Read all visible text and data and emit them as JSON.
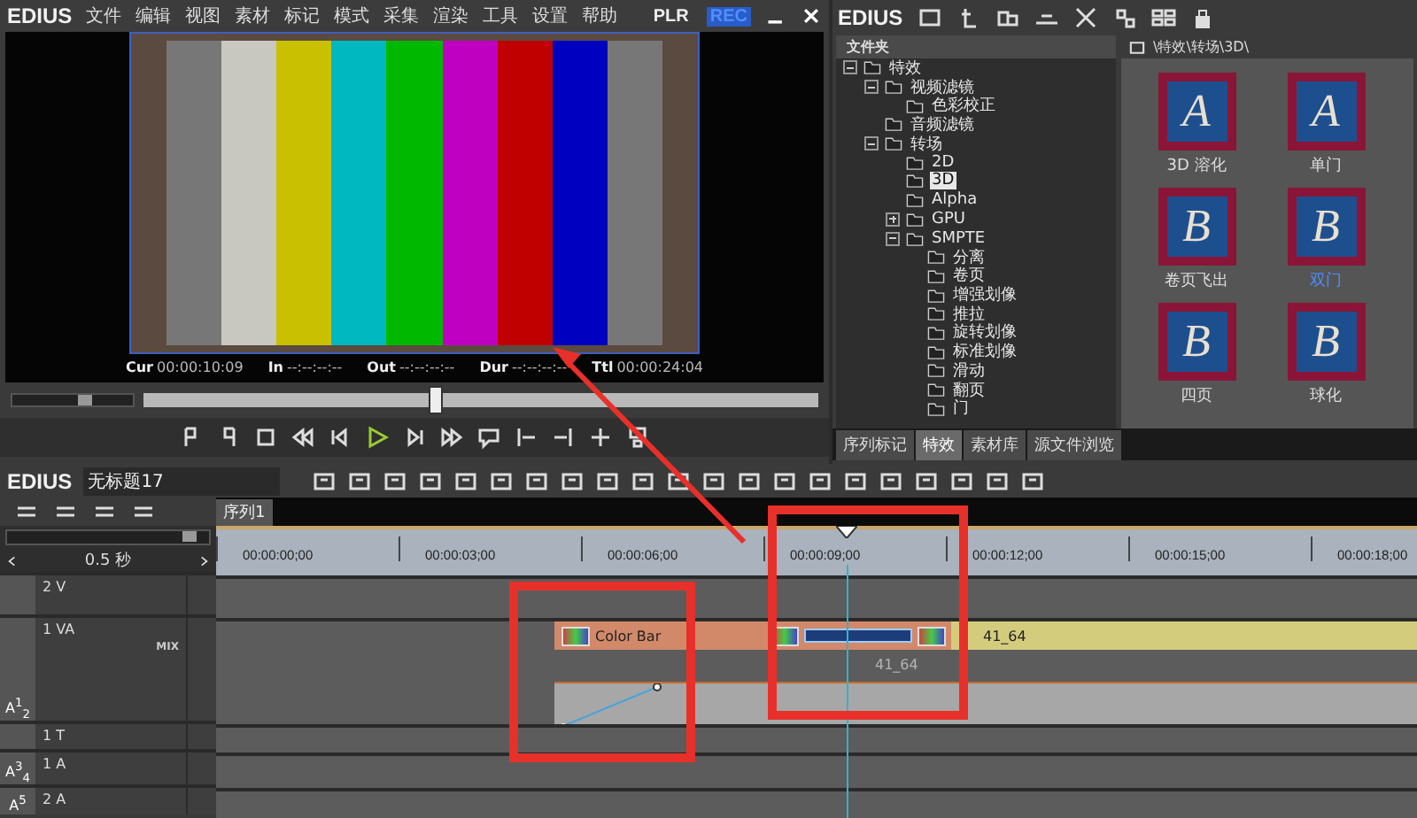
{
  "menu_bar": {
    "app": "EDIUS",
    "items": [
      "文件",
      "编辑",
      "视图",
      "素材",
      "标记",
      "模式",
      "采集",
      "渲染",
      "工具",
      "设置",
      "帮助"
    ],
    "modes": [
      {
        "label": "PLR",
        "selected": false
      },
      {
        "label": "REC",
        "selected": true
      }
    ]
  },
  "player": {
    "timecodes": [
      {
        "label": "Cur",
        "value": "00:00:10:09"
      },
      {
        "label": "In",
        "value": "--:--:--:--"
      },
      {
        "label": "Out",
        "value": "--:--:--:--"
      },
      {
        "label": "Dur",
        "value": "--:--:--:--"
      },
      {
        "label": "Ttl",
        "value": "00:00:24:04"
      }
    ],
    "volume": {
      "level": 0.6
    },
    "scrubber": {
      "level": 0.43
    }
  },
  "library": {
    "app": "EDIUS",
    "tree_header": "文件夹",
    "path": "\\特效\\转场\\3D\\",
    "tree": [
      {
        "label": "特效",
        "expanded": true,
        "selected": false,
        "children": [
          {
            "label": "视频滤镜",
            "expanded": true,
            "selected": false,
            "children": [
              {
                "label": "色彩校正",
                "selected": false
              }
            ]
          },
          {
            "label": "音频滤镜",
            "selected": false
          },
          {
            "label": "转场",
            "expanded": true,
            "selected": false,
            "children": [
              {
                "label": "2D",
                "selected": false
              },
              {
                "label": "3D",
                "selected": true
              },
              {
                "label": "Alpha",
                "selected": false
              },
              {
                "label": "GPU",
                "expanded": false,
                "selected": false
              },
              {
                "label": "SMPTE",
                "expanded": true,
                "selected": false,
                "children": [
                  {
                    "label": "分离",
                    "selected": false
                  },
                  {
                    "label": "卷页",
                    "selected": false
                  },
                  {
                    "label": "增强划像",
                    "selected": false
                  },
                  {
                    "label": "推拉",
                    "selected": false
                  },
                  {
                    "label": "旋转划像",
                    "selected": false
                  },
                  {
                    "label": "标准划像",
                    "selected": false
                  },
                  {
                    "label": "滑动",
                    "selected": false
                  },
                  {
                    "label": "翻页",
                    "selected": false
                  },
                  {
                    "label": "门",
                    "selected": false
                  }
                ]
              }
            ]
          }
        ]
      }
    ],
    "thumbnails": [
      {
        "letter": "A",
        "label": "3D 溶化",
        "selected": false
      },
      {
        "letter": "A",
        "label": "单门",
        "selected": false
      },
      {
        "letter": "B",
        "label": "卷页飞出",
        "selected": false
      },
      {
        "letter": "B",
        "label": "双门",
        "selected": true
      },
      {
        "letter": "B",
        "label": "四页",
        "selected": false
      },
      {
        "letter": "B",
        "label": "球化",
        "selected": false
      }
    ],
    "tabs": [
      {
        "label": "序列标记",
        "selected": false
      },
      {
        "label": "特效",
        "selected": true
      },
      {
        "label": "素材库",
        "selected": false
      },
      {
        "label": "源文件浏览",
        "selected": false
      }
    ]
  },
  "timeline": {
    "app": "EDIUS",
    "project": "无标题17",
    "sequence_tab": "序列1",
    "zoom": "0.5 秒",
    "volume": {
      "level": 0.9
    },
    "ruler": [
      "00:00:00;00",
      "00:00:03;00",
      "00:00:06;00",
      "00:00:09;00",
      "00:00:12;00",
      "00:00:15;00",
      "00:00:18;00"
    ],
    "playhead": {
      "level": 0.525
    },
    "tracks": [
      {
        "name": "2 V",
        "kind": "video"
      },
      {
        "name": "1 VA",
        "kind": "va",
        "badge": "A$^{1}$$_{2}$",
        "mix": "MIX"
      },
      {
        "name": "1 T",
        "kind": "title"
      },
      {
        "name": "1 A",
        "kind": "audio",
        "badge": "A$^{3}$$_{4}$"
      },
      {
        "name": "2 A",
        "kind": "audio",
        "badge": "A$^{5}$"
      }
    ],
    "clips": [
      {
        "label": "Color Bar",
        "kind": "colorbar"
      },
      {
        "label": "41_64",
        "kind": "video",
        "ghost_label": "41_64"
      }
    ]
  }
}
